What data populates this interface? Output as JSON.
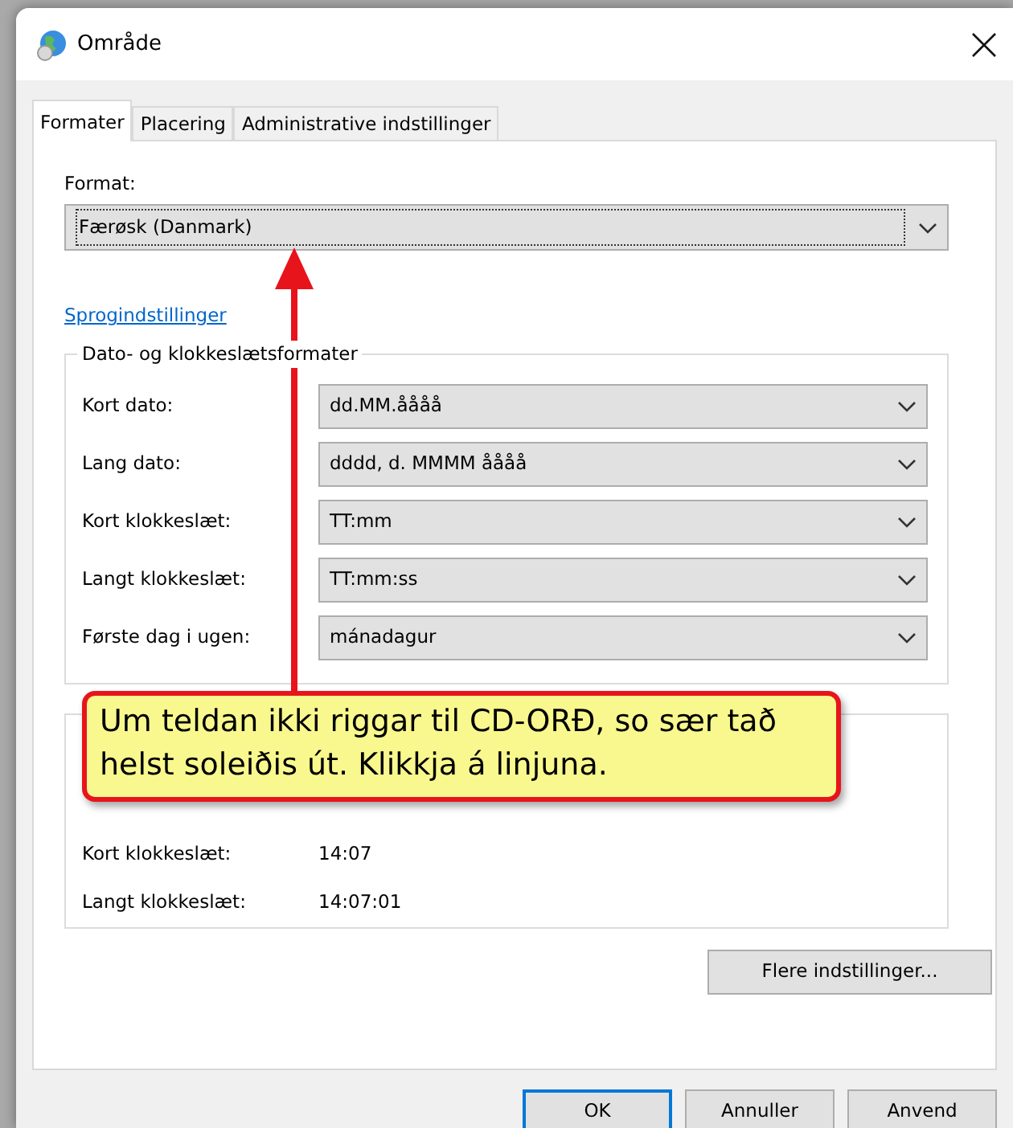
{
  "window": {
    "title": "Område"
  },
  "tabs": [
    {
      "label": "Formater",
      "selected": true
    },
    {
      "label": "Placering",
      "selected": false
    },
    {
      "label": "Administrative indstillinger",
      "selected": false
    }
  ],
  "format": {
    "label": "Format:",
    "value": "Færøsk (Danmark)"
  },
  "language_link": "Sprogindstillinger",
  "formats_group": {
    "title": "Dato- og klokkeslætsformater",
    "rows": [
      {
        "label": "Kort dato:",
        "value": "dd.MM.åååå"
      },
      {
        "label": "Lang dato:",
        "value": "dddd, d. MMMM åååå"
      },
      {
        "label": "Kort klokkeslæt:",
        "value": "TT:mm"
      },
      {
        "label": "Langt klokkeslæt:",
        "value": "TT:mm:ss"
      },
      {
        "label": "Første dag i ugen:",
        "value": "mánadagur"
      }
    ]
  },
  "examples_group": {
    "rows": [
      {
        "label": "Kort klokkeslæt:",
        "value": "14:07"
      },
      {
        "label": "Langt klokkeslæt:",
        "value": "14:07:01"
      }
    ]
  },
  "more_button": "Flere indstillinger...",
  "buttons": [
    {
      "label": "OK",
      "default": true
    },
    {
      "label": "Annuller",
      "default": false
    },
    {
      "label": "Anvend",
      "default": false
    }
  ],
  "callout": {
    "text": "Um teldan ikki riggar til CD-ORÐ, so sær tað helst soleiðis út. Klikkja á linjuna."
  }
}
